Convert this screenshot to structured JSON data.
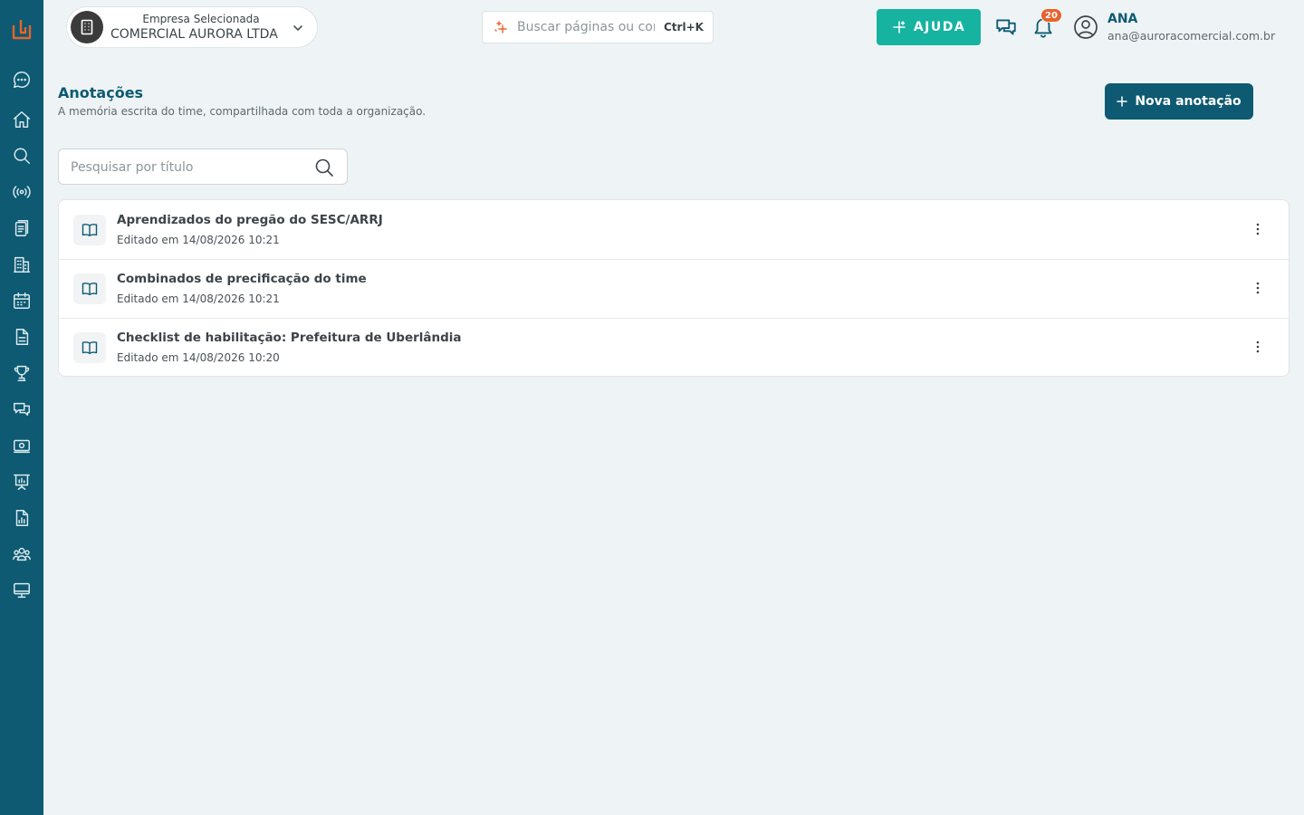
{
  "company": {
    "label": "Empresa Selecionada",
    "name": "COMERCIAL AURORA LTDA"
  },
  "topbar": {
    "search_placeholder": "Buscar páginas ou conteúdos",
    "search_shortcut": "Ctrl+K",
    "help_label": "AJUDA",
    "notification_count": "20",
    "user_name": "ANA",
    "user_email": "ana@auroracomercial.com.br"
  },
  "page": {
    "title": "Anotações",
    "subtitle": "A memória escrita do time, compartilhada com toda a organização.",
    "new_button_label": "Nova anotação",
    "title_search_placeholder": "Pesquisar por título"
  },
  "notes": [
    {
      "title": "Aprendizados do pregão do SESC/ARRJ",
      "edited": "Editado em 14/08/2026 10:21"
    },
    {
      "title": "Combinados de precificação do time",
      "edited": "Editado em 14/08/2026 10:21"
    },
    {
      "title": "Checklist de habilitação: Prefeitura de Uberlândia",
      "edited": "Editado em 14/08/2026 10:20"
    }
  ],
  "sidebar": {
    "icons": [
      "logo-icon",
      "chat-icon",
      "home-icon",
      "search-icon",
      "broadcast-icon",
      "clipboard-icon",
      "building-icon",
      "calendar-icon",
      "document-icon",
      "trophy-icon",
      "messages-icon",
      "money-icon",
      "presentation-icon",
      "report-icon",
      "team-icon",
      "monitor-icon"
    ]
  },
  "colors": {
    "sidebar": "#0d5a72",
    "primary": "#0d5a72",
    "help": "#16b3a1",
    "badge": "#e8622c",
    "logo": "#e8622c",
    "background": "#eef4f5"
  }
}
